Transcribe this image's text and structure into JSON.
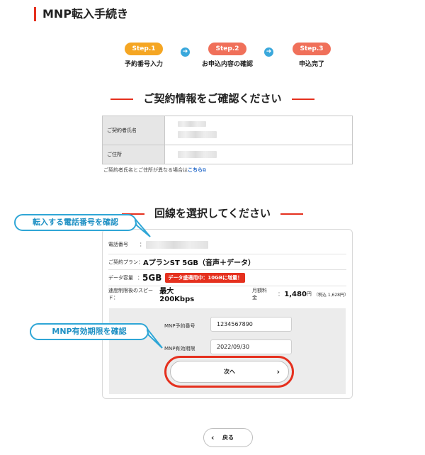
{
  "header": {
    "title": "MNP転入手続き"
  },
  "steps": [
    {
      "pill": "Step.1",
      "label": "予約番号入力",
      "color": "#f5a623"
    },
    {
      "pill": "Step.2",
      "label": "お申込内容の確認",
      "color": "#f0705a"
    },
    {
      "pill": "Step.3",
      "label": "申込完了",
      "color": "#f0705a"
    }
  ],
  "contract": {
    "heading": "ご契約情報をご確認ください",
    "name_label": "ご契約者氏名",
    "address_label": "ご住所",
    "note_text": "ご契約者氏名とご住所が異なる場合は",
    "note_link": "こちら"
  },
  "line": {
    "heading": "回線を選択してください",
    "phone_label": "電話番号",
    "phone_colon": "：",
    "plan_label": "ご契約プラン：",
    "plan_value": "AプランST 5GB（音声＋データ）",
    "data_label": "データ容量",
    "data_colon": "：",
    "data_value": "5GB",
    "data_badge": "データ盛適用中：10GBに増量！",
    "speed_label": "速度制限後のスピード：",
    "speed_value": "最大200Kbps",
    "fee_label": "月額料金",
    "fee_colon": "：",
    "fee_value": "1,480",
    "fee_unit": "円",
    "fee_tax": "（税込 1,628円）"
  },
  "mnp": {
    "number_label": "MNP予約番号",
    "number_value": "1234567890",
    "expiry_label": "MNP有効期限",
    "expiry_value": "2022/09/30"
  },
  "buttons": {
    "next": "次へ",
    "back": "戻る"
  },
  "callouts": {
    "phone": "転入する電話番号を確認",
    "expiry": "MNP有効期限を確認"
  },
  "colors": {
    "accent_red": "#e5301e",
    "callout_blue": "#2fa6d6",
    "step_orange": "#f5a623",
    "step_salmon": "#f0705a"
  }
}
